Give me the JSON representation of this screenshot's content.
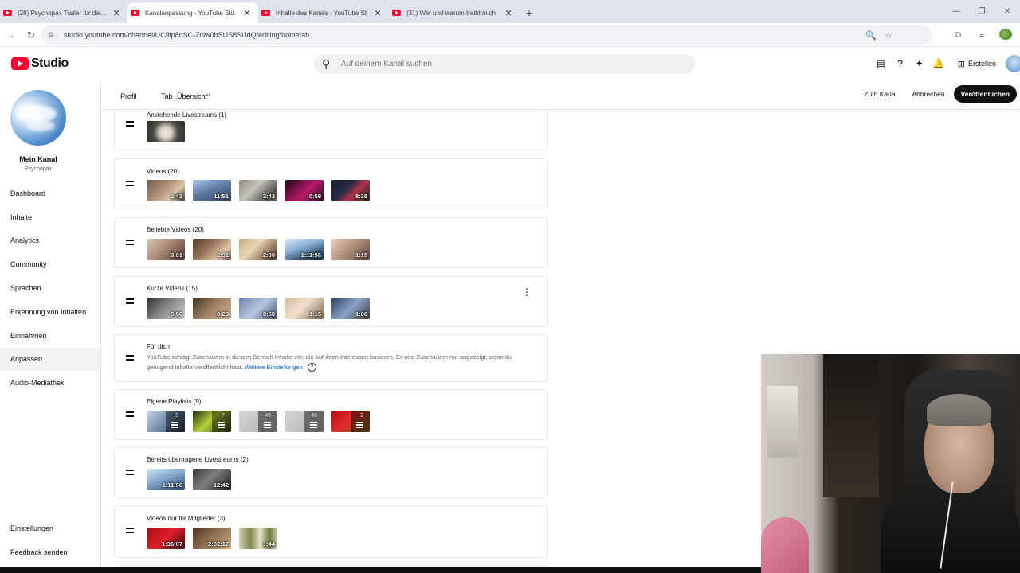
{
  "browser": {
    "tabs": [
      {
        "title": "(28) Psychopax Trailer für die Ur",
        "close": "✕"
      },
      {
        "title": "Kanalanpassung - YouTube Stu",
        "close": "✕"
      },
      {
        "title": "Inhalte des Kanals - YouTube St",
        "close": "✕"
      },
      {
        "title": "(31) Wer und warum treibt mich",
        "close": "✕"
      }
    ],
    "url": "studio.youtube.com/channel/UC9lp8oSC-Zciw0hSUS8SUdQ/editing/hometab"
  },
  "header": {
    "logo_text": "Studio",
    "search_placeholder": "Auf deinem Kanal suchen",
    "create_label": "Erstellen"
  },
  "sidebar": {
    "channel_name": "Mein Kanal",
    "channel_handle": "Psychopax",
    "items": [
      {
        "label": "Dashboard"
      },
      {
        "label": "Inhalte"
      },
      {
        "label": "Analytics"
      },
      {
        "label": "Community"
      },
      {
        "label": "Sprachen"
      },
      {
        "label": "Erkennung von Inhalten"
      },
      {
        "label": "Einnahmen"
      },
      {
        "label": "Anpassen"
      },
      {
        "label": "Audio-Mediathek"
      }
    ],
    "bottom_items": [
      {
        "label": "Einstellungen"
      },
      {
        "label": "Feedback senden"
      }
    ]
  },
  "subheader": {
    "tabs": [
      {
        "label": "Profil"
      },
      {
        "label": "Tab „Übersicht“"
      }
    ],
    "view_channel": "Zum Kanal",
    "cancel": "Abbrechen",
    "publish": "Veröffentlichen"
  },
  "sections": [
    {
      "title": "Anstehende Livestreams (1)",
      "thumbs": [
        {
          "duration": ""
        }
      ]
    },
    {
      "title": "Videos (20)",
      "thumbs": [
        {
          "duration": "2:43"
        },
        {
          "duration": "11:51"
        },
        {
          "duration": "2:43"
        },
        {
          "duration": "0:59"
        },
        {
          "duration": "8:38"
        }
      ]
    },
    {
      "title": "Beliebte Videos (20)",
      "thumbs": [
        {
          "duration": "3:01"
        },
        {
          "duration": "2:31"
        },
        {
          "duration": "2:00"
        },
        {
          "duration": "1:11:56"
        },
        {
          "duration": "1:15"
        }
      ]
    },
    {
      "title": "Kurze Videos (15)",
      "thumbs": [
        {
          "duration": "0:50"
        },
        {
          "duration": "0:29"
        },
        {
          "duration": "0:50"
        },
        {
          "duration": "1:15"
        },
        {
          "duration": "1:06"
        }
      ]
    },
    {
      "title": "Für dich",
      "description": "YouTube schlägt Zuschauern in diesem Bereich Inhalte vor, die auf ihren Interessen basieren. Er wird Zuschauern nur angezeigt, wenn du genügend Inhalte veröffentlicht hast.",
      "link": "Weitere Einstellungen",
      "help": "?"
    },
    {
      "title": "Eigene Playlists (9)",
      "thumbs": [
        {
          "count": "3"
        },
        {
          "count": "7"
        },
        {
          "count": "46"
        },
        {
          "count": "46"
        },
        {
          "count": "2"
        }
      ]
    },
    {
      "title": "Bereits übertragene Livestreams (2)",
      "thumbs": [
        {
          "duration": "1:11:56"
        },
        {
          "duration": "12:42"
        }
      ]
    },
    {
      "title": "Videos nur für Mitglieder (3)",
      "thumbs": [
        {
          "duration": "1:36:07"
        },
        {
          "duration": "2:02:17"
        },
        {
          "duration": "1:44"
        }
      ]
    }
  ],
  "icons": {
    "back": "→",
    "reload": "↻",
    "site": "⚙",
    "zoom": "🔍",
    "star": "☆",
    "extensions": "⧉",
    "media": "≡",
    "search": "⚲",
    "feedback": "▤",
    "help": "?",
    "spark": "✦",
    "bell": "🔔",
    "create": "⊞",
    "kebab": "⋮",
    "new_tab": "+",
    "minimize": "—",
    "restore": "❐",
    "close": "✕"
  }
}
